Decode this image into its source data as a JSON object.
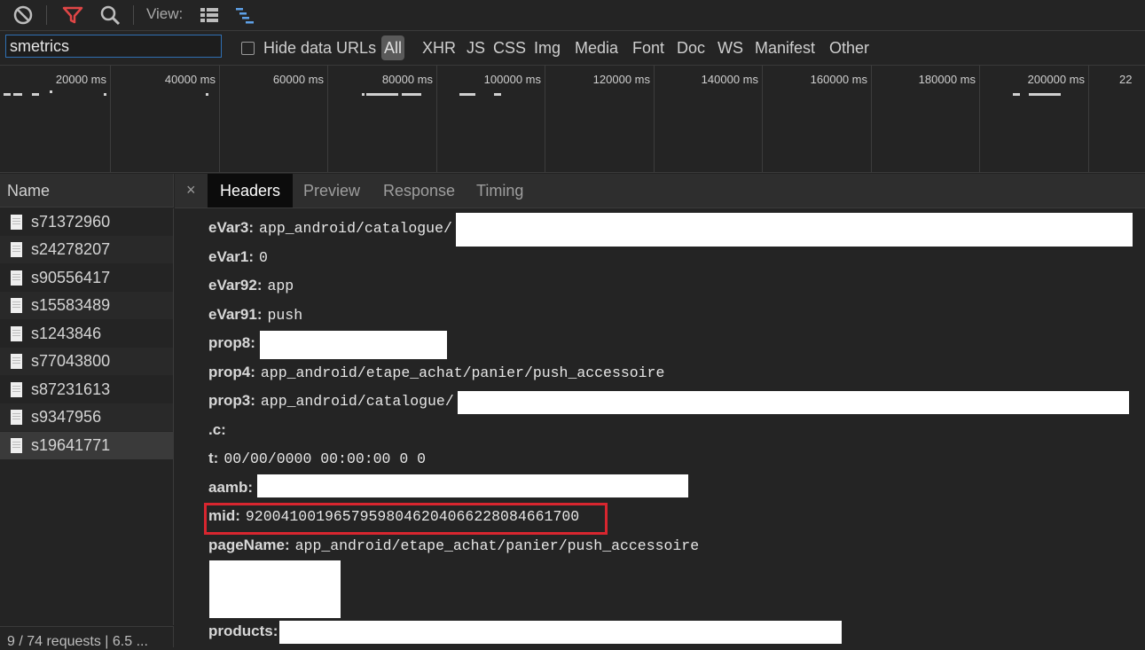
{
  "toolbar": {
    "view_label": "View:",
    "icons": [
      "block-icon",
      "filter-icon",
      "search-icon",
      "list-view-icon",
      "waterfall-view-icon"
    ]
  },
  "filter": {
    "value": "smetrics",
    "hide_data_urls": "Hide data URLs",
    "types": [
      "All",
      "XHR",
      "JS",
      "CSS",
      "Img",
      "Media",
      "Font",
      "Doc",
      "WS",
      "Manifest",
      "Other"
    ]
  },
  "overview": {
    "ticks": [
      "20000 ms",
      "40000 ms",
      "60000 ms",
      "80000 ms",
      "100000 ms",
      "120000 ms",
      "140000 ms",
      "160000 ms",
      "180000 ms",
      "200000 ms",
      "22"
    ]
  },
  "requests": {
    "header": "Name",
    "items": [
      "s71372960",
      "s24278207",
      "s90556417",
      "s15583489",
      "s1243846",
      "s77043800",
      "s87231613",
      "s9347956",
      "s19641771"
    ],
    "status": "9 / 74 requests | 6.5 ..."
  },
  "tabs": {
    "close": "×",
    "items": [
      "Headers",
      "Preview",
      "Response",
      "Timing"
    ],
    "active": "Headers"
  },
  "params": [
    {
      "key": "eVar3:",
      "value": "app_android/catalogue/"
    },
    {
      "key": "eVar1:",
      "value": "0"
    },
    {
      "key": "eVar92:",
      "value": "app"
    },
    {
      "key": "eVar91:",
      "value": "push"
    },
    {
      "key": "prop8:",
      "value": ""
    },
    {
      "key": "prop4:",
      "value": "app_android/etape_achat/panier/push_accessoire"
    },
    {
      "key": "prop3:",
      "value": "app_android/catalogue/"
    },
    {
      "key": ".c:",
      "value": ""
    },
    {
      "key": "t:",
      "value": "00/00/0000 00:00:00 0 0"
    },
    {
      "key": "aamb:",
      "value": ""
    },
    {
      "key": "mid:",
      "value": "92004100196579598046204066228084661700"
    },
    {
      "key": "pageName:",
      "value": "app_android/etape_achat/panier/push_accessoire"
    },
    {
      "key": "products:",
      "value": ""
    }
  ],
  "colors": {
    "highlight": "#d8262f",
    "filter_icon": "#e04646",
    "view_waterfall": "#5ea0e6"
  }
}
